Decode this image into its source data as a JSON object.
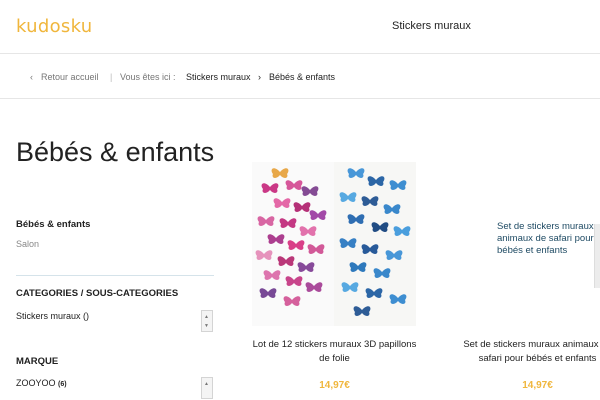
{
  "header": {
    "logo": "kudosku",
    "nav_link": "Stickers muraux"
  },
  "breadcrumb": {
    "back": "Retour accueil",
    "separator": "|",
    "you_are_here": "Vous êtes ici :",
    "items": [
      "Stickers muraux",
      "Bébés & enfants"
    ]
  },
  "page": {
    "title": "Bébés & enfants"
  },
  "filters": {
    "active_category": "Bébés & enfants",
    "other_category": "Salon",
    "categories_title": "CATEGORIES / SOUS-CATEGORIES",
    "category_item": "Stickers muraux",
    "category_count": "()",
    "brand_title": "MARQUE",
    "brand_item": "ZOOYOO",
    "brand_count": "(6)"
  },
  "products": [
    {
      "name": "Lot de 12 stickers muraux 3D papillons de folie",
      "price": "14,97€",
      "image": "butterflies-photo"
    },
    {
      "name": "Set de stickers muraux animaux de safari pour bébés et enfants",
      "price": "14,97€",
      "image_alt": "Set de stickers muraux animaux de safari pour bébés et enfants"
    }
  ],
  "colors": {
    "accent": "#f0b63c",
    "text": "#222222",
    "muted": "#888888",
    "link": "#1e4a63"
  },
  "icons": {
    "back": "chevron-left-icon",
    "breadcrumb_sep": "chevron-right-icon",
    "scroll": "scroll-arrows-icon"
  }
}
